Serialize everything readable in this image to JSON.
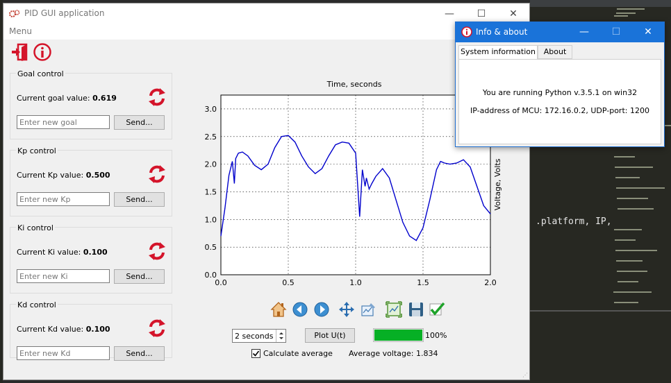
{
  "window": {
    "title": "PID GUI application",
    "menu": "Menu",
    "minimize": "—",
    "maximize": "☐",
    "close": "✕"
  },
  "toolbar": {
    "icons": [
      "exit-icon",
      "info-icon"
    ]
  },
  "groups": [
    {
      "title": "Goal control",
      "label": "Current goal value: ",
      "value": "0.619",
      "placeholder": "Enter new goal",
      "send": "Send..."
    },
    {
      "title": "Kp control",
      "label": "Current Kp value: ",
      "value": "0.500",
      "placeholder": "Enter new Kp",
      "send": "Send..."
    },
    {
      "title": "Ki control",
      "label": "Current Ki value: ",
      "value": "0.100",
      "placeholder": "Enter new Ki",
      "send": "Send..."
    },
    {
      "title": "Kd control",
      "label": "Current Kd value: ",
      "value": "0.100",
      "placeholder": "Enter new Kd",
      "send": "Send..."
    }
  ],
  "chart_data": {
    "type": "line",
    "title": "Time, seconds",
    "xlabel": "Time, seconds",
    "ylabel": "Voltage, Volts",
    "xlim": [
      0.0,
      2.0
    ],
    "ylim": [
      0.0,
      3.25
    ],
    "xticks": [
      "0.0",
      "0.5",
      "1.0",
      "1.5",
      "2.0"
    ],
    "yticks": [
      "0.0",
      "0.5",
      "1.0",
      "1.5",
      "2.0",
      "2.5",
      "3.0"
    ],
    "grid": true,
    "color": "#0000cc",
    "x": [
      0.0,
      0.03,
      0.06,
      0.085,
      0.1,
      0.11,
      0.13,
      0.16,
      0.2,
      0.25,
      0.3,
      0.35,
      0.4,
      0.45,
      0.5,
      0.55,
      0.6,
      0.65,
      0.7,
      0.75,
      0.8,
      0.85,
      0.9,
      0.95,
      1.0,
      1.03,
      1.05,
      1.07,
      1.08,
      1.1,
      1.12,
      1.15,
      1.2,
      1.25,
      1.3,
      1.35,
      1.4,
      1.45,
      1.5,
      1.55,
      1.6,
      1.63,
      1.66,
      1.7,
      1.75,
      1.8,
      1.85,
      1.9,
      1.95,
      2.0
    ],
    "y": [
      0.7,
      1.2,
      1.8,
      2.05,
      1.65,
      2.1,
      2.2,
      2.22,
      2.15,
      1.98,
      1.9,
      2.0,
      2.3,
      2.5,
      2.52,
      2.4,
      2.15,
      1.95,
      1.83,
      1.92,
      2.15,
      2.35,
      2.4,
      2.38,
      2.2,
      1.05,
      1.9,
      1.6,
      1.75,
      1.55,
      1.65,
      1.78,
      1.92,
      1.75,
      1.35,
      0.95,
      0.7,
      0.62,
      0.85,
      1.35,
      1.9,
      2.05,
      2.02,
      2.0,
      2.02,
      2.08,
      1.95,
      1.6,
      1.25,
      1.1
    ]
  },
  "nav_icons": [
    "home-icon",
    "back-icon",
    "forward-icon",
    "pan-icon",
    "configure-icon",
    "zoom-icon",
    "save-icon",
    "check-icon"
  ],
  "controls": {
    "duration": "2 seconds",
    "plot_button": "Plot U(t)",
    "progress": 100,
    "progress_text": "100%",
    "calc_avg_label": "Calculate average",
    "calc_avg_checked": true,
    "avg_voltage": "Average voltage: 1.834"
  },
  "info_dialog": {
    "title": "Info & about",
    "tabs": [
      "System information",
      "About"
    ],
    "python_line": "You are running Python v.3.5.1 on win32",
    "ip_line": "IP-address of MCU: 172.16.0.2, UDP-port: 1200"
  },
  "background_editor": {
    "code_text": ".platform, IP,"
  }
}
